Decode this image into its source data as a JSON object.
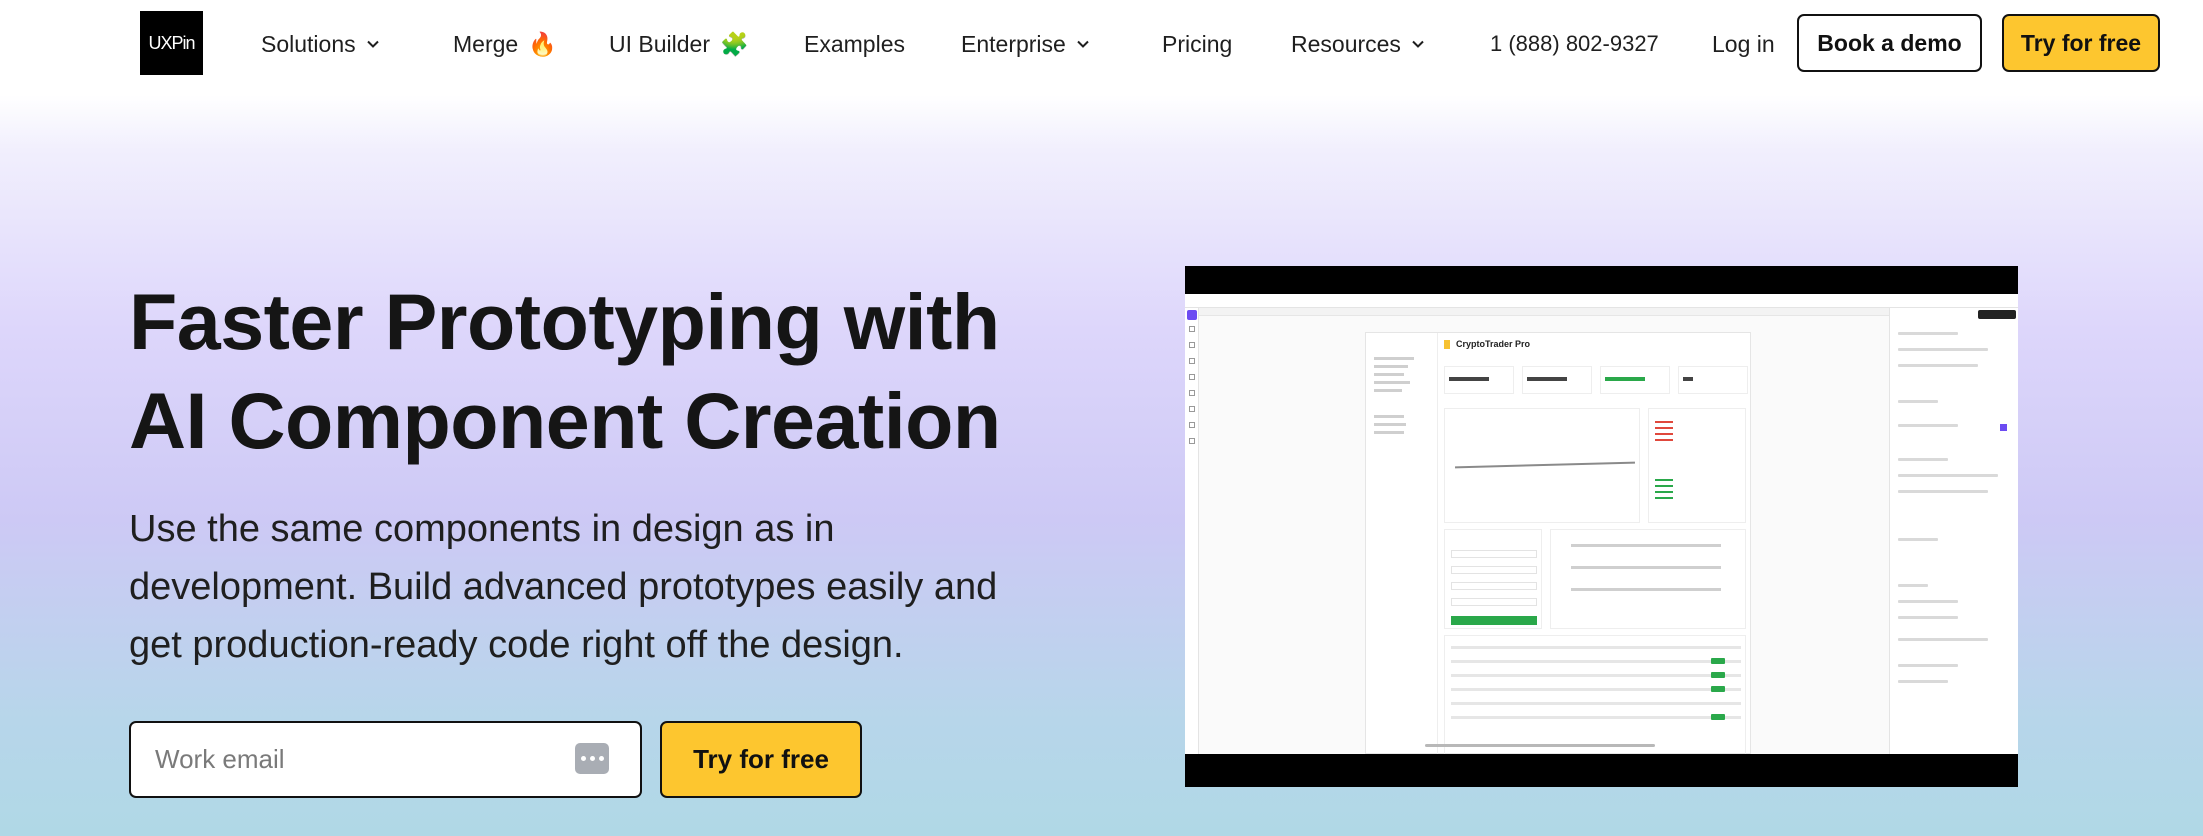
{
  "header": {
    "logo_text": "UXPin",
    "nav": [
      {
        "label": "Solutions",
        "dropdown": true
      },
      {
        "label": "Merge",
        "icon": "fire-emoji",
        "glyph": "🔥"
      },
      {
        "label": "UI Builder",
        "icon": "puzzle-emoji",
        "glyph": "🧩"
      },
      {
        "label": "Examples"
      },
      {
        "label": "Enterprise",
        "dropdown": true
      },
      {
        "label": "Pricing"
      },
      {
        "label": "Resources",
        "dropdown": true
      }
    ],
    "phone": "1 (888) 802-9327",
    "login": "Log in",
    "book_demo": "Book a demo",
    "try_free": "Try for free"
  },
  "hero": {
    "title_lines": [
      "Faster Prototyping with",
      "AI Component Creation"
    ],
    "subtitle_lines": [
      "Use the same components in design as in",
      "development. Build advanced prototypes easily and",
      "get production-ready code right off the design."
    ],
    "email_placeholder": "Work email",
    "cta": "Try for free"
  },
  "video": {
    "app_title": "CryptoTrader Pro"
  },
  "colors": {
    "accent_yellow": "#fdc62f",
    "brand_purple": "#6c4bf2",
    "positive_green": "#2aa84a"
  }
}
